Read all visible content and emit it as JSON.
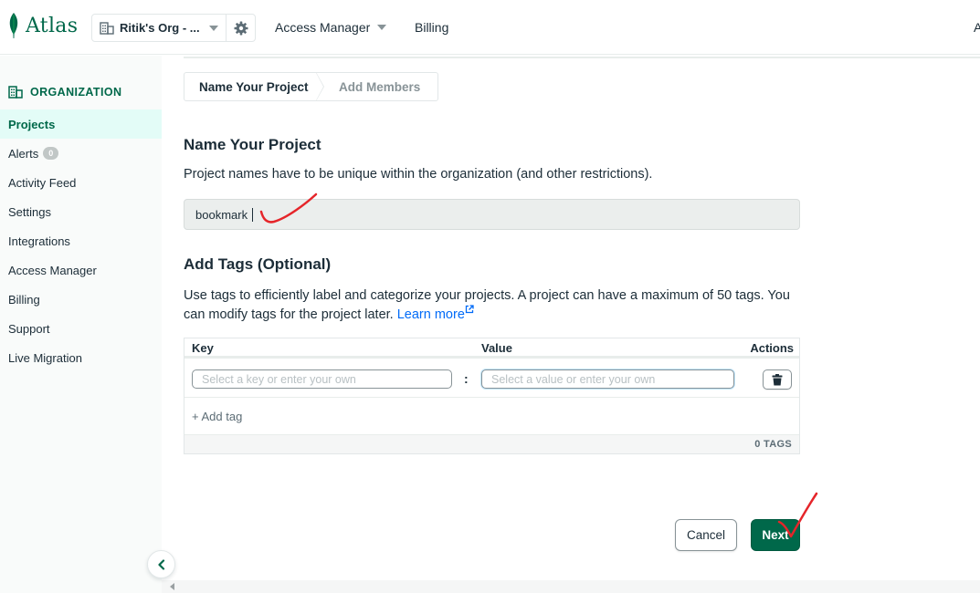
{
  "topbar": {
    "logo_text": "Atlas",
    "org_name": "Ritik's Org - ...",
    "nav_access_manager": "Access Manager",
    "nav_billing": "Billing",
    "nav_right_partial": "A"
  },
  "sidebar": {
    "section_title": "ORGANIZATION",
    "items": [
      {
        "label": "Projects",
        "active": true
      },
      {
        "label": "Alerts",
        "badge": "0"
      },
      {
        "label": "Activity Feed"
      },
      {
        "label": "Settings"
      },
      {
        "label": "Integrations"
      },
      {
        "label": "Access Manager"
      },
      {
        "label": "Billing"
      },
      {
        "label": "Support"
      },
      {
        "label": "Live Migration"
      }
    ]
  },
  "steps": {
    "step1": "Name Your Project",
    "step2": "Add Members"
  },
  "name_section": {
    "title": "Name Your Project",
    "description": "Project names have to be unique within the organization (and other restrictions).",
    "input_value": "bookmark"
  },
  "tags_section": {
    "title": "Add Tags (Optional)",
    "description": "Use tags to efficiently label and categorize your projects. A project can have a maximum of 50 tags. You can modify tags for the project later.",
    "learn_more": "Learn more",
    "columns": {
      "key": "Key",
      "value": "Value",
      "actions": "Actions"
    },
    "key_placeholder": "Select a key or enter your own",
    "value_placeholder": "Select a value or enter your own",
    "colon": ":",
    "add_tag": "+ Add tag",
    "count": "0 TAGS"
  },
  "footer": {
    "cancel": "Cancel",
    "next": "Next"
  },
  "colors": {
    "brand_green": "#00684a",
    "active_bg": "#e3fcf7",
    "link_blue": "#016bf8",
    "annotation_red": "#e5252a"
  },
  "icons": {
    "logo": "leaf-icon",
    "org": "building-icon",
    "settings": "gear-icon",
    "external": "external-link-icon",
    "delete": "trash-icon",
    "collapse": "chevron-left-icon"
  }
}
